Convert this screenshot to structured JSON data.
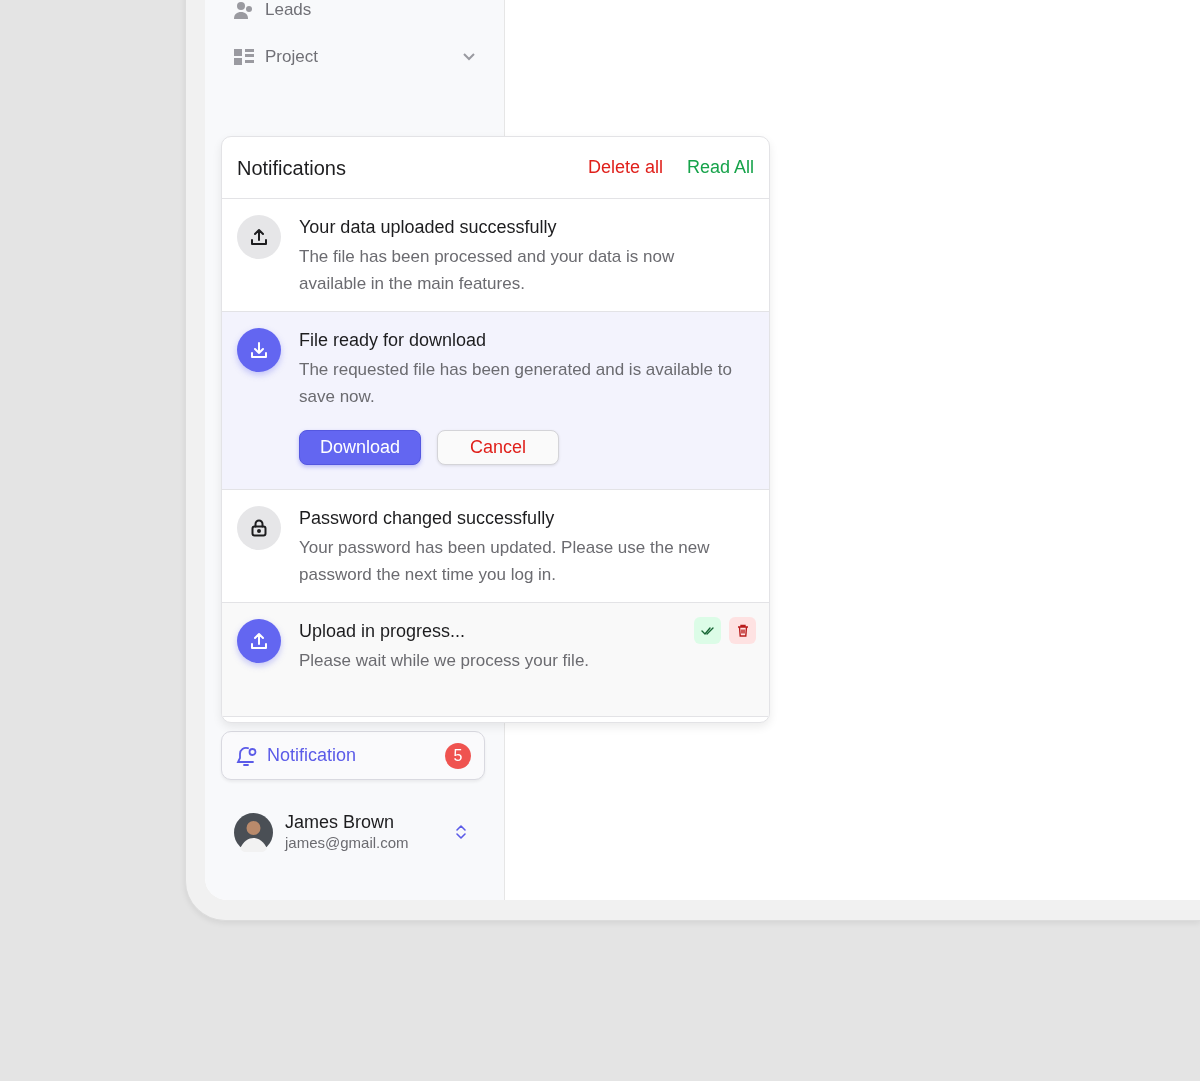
{
  "sidebar": {
    "items": [
      {
        "label": "Leads",
        "expandable": false
      },
      {
        "label": "Project",
        "expandable": true
      }
    ]
  },
  "notifications_panel": {
    "title": "Notifications",
    "delete_all": "Delete all",
    "read_all": "Read All",
    "items": [
      {
        "kind": "upload",
        "accent": false,
        "highlighted": false,
        "hovered": false,
        "title": "Your data uploaded successfully",
        "body": "The file has been processed and your data is now available in the main features."
      },
      {
        "kind": "download",
        "accent": true,
        "highlighted": true,
        "hovered": false,
        "title": "File ready for download",
        "body": "The requested file has been generated and is available to save now.",
        "actions": [
          {
            "label": "Download",
            "kind": "primary"
          },
          {
            "label": "Cancel",
            "kind": "secondary"
          }
        ]
      },
      {
        "kind": "lock",
        "accent": false,
        "highlighted": false,
        "hovered": false,
        "title": "Password changed successfully",
        "body": "Your password has been updated. Please use the new password the next time you log in."
      },
      {
        "kind": "upload",
        "accent": true,
        "highlighted": false,
        "hovered": true,
        "title": "Upload in progress...",
        "body": "Please wait while we process your file."
      }
    ]
  },
  "notification_button": {
    "label": "Notification",
    "count": "5"
  },
  "user": {
    "name": "James Brown",
    "email": "james@gmail.com"
  }
}
